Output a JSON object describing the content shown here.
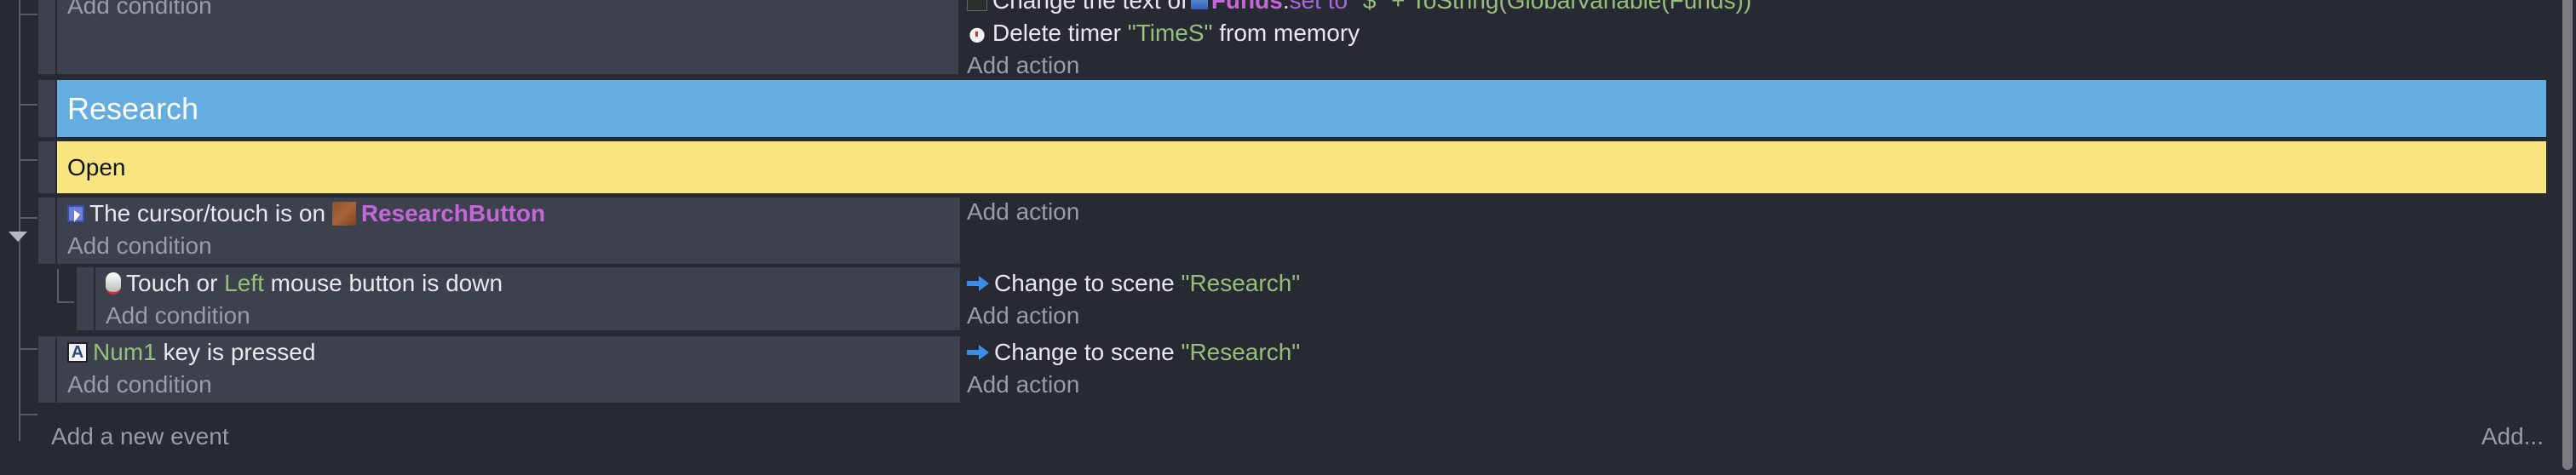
{
  "previous_event": {
    "add_condition": "Add condition",
    "actions": [
      {
        "icon": "text-icon",
        "prefix": "Change the text of ",
        "object": "Funds",
        "sep": ": ",
        "keyword": "set to",
        "value": " \"$\" + ToString(GlobalVariable(Funds))"
      },
      {
        "icon": "timer-icon",
        "prefix": "Delete timer ",
        "value": "\"TimeS\"",
        "suffix": " from memory"
      }
    ],
    "add_action": "Add action"
  },
  "group": {
    "title": "Research",
    "color": "#64ade0"
  },
  "comment": {
    "text": "Open",
    "color": "#f9e57f"
  },
  "events": [
    {
      "conditions": [
        {
          "icon": "cursor-icon",
          "text": "The cursor/touch is on ",
          "object": "ResearchButton"
        }
      ],
      "add_condition": "Add condition",
      "add_action": "Add action",
      "sub_event": {
        "conditions": [
          {
            "icon": "mouse-icon",
            "prefix": "Touch or ",
            "value": "Left",
            "suffix": " mouse button is down"
          }
        ],
        "add_condition": "Add condition",
        "actions": [
          {
            "icon": "scene-arrow-icon",
            "text": "Change to scene ",
            "value": "\"Research\""
          }
        ],
        "add_action": "Add action"
      }
    },
    {
      "conditions": [
        {
          "icon": "keyboard-key-icon",
          "key_glyph": "A",
          "value": "Num1",
          "suffix": " key is pressed"
        }
      ],
      "add_condition": "Add condition",
      "actions": [
        {
          "icon": "scene-arrow-icon",
          "text": "Change to scene ",
          "value": "\"Research\""
        }
      ],
      "add_action": "Add action"
    }
  ],
  "footer": {
    "add_event": "Add a new event",
    "add_more": "Add..."
  }
}
